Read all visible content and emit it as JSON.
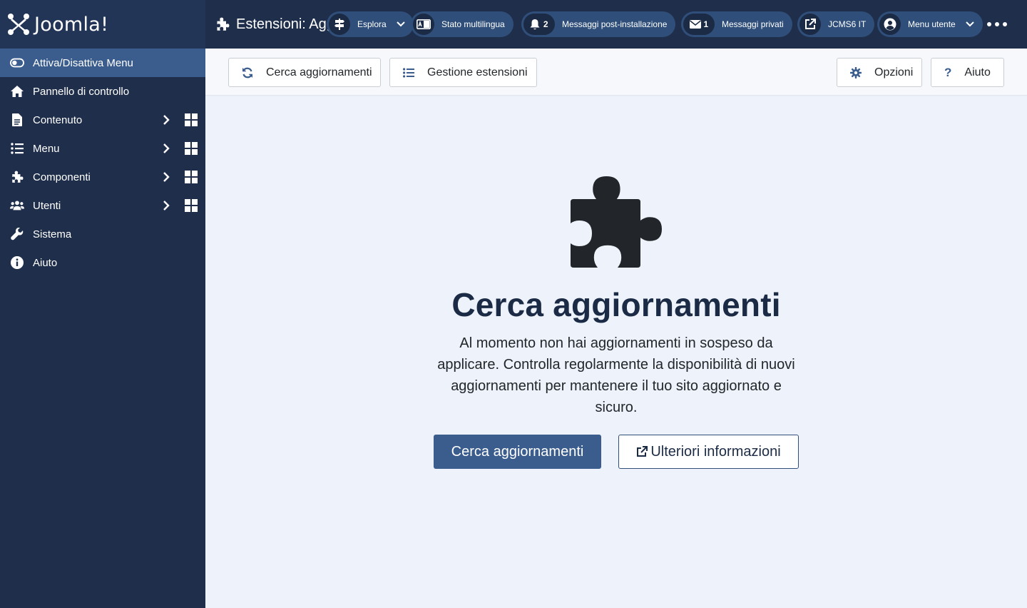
{
  "brand": {
    "name": "Joomla!"
  },
  "sidebar": {
    "items": [
      {
        "label": "Attiva/Disattiva Menu",
        "icon": "toggle-icon"
      },
      {
        "label": "Pannello di controllo",
        "icon": "home-icon"
      },
      {
        "label": "Contenuto",
        "icon": "file-icon"
      },
      {
        "label": "Menu",
        "icon": "list-icon"
      },
      {
        "label": "Componenti",
        "icon": "puzzle-icon"
      },
      {
        "label": "Utenti",
        "icon": "users-icon"
      },
      {
        "label": "Sistema",
        "icon": "wrench-icon"
      },
      {
        "label": "Aiuto",
        "icon": "info-icon"
      }
    ]
  },
  "header": {
    "title": "Estensioni: Aggiornamenti",
    "explore_label": "Esplora",
    "multilang_label": "Stato multilingua",
    "postinstall_count": "2",
    "postinstall_label": "Messaggi post-installazione",
    "private_count": "1",
    "private_label": "Messaggi privati",
    "site_label": "JCMS6 IT",
    "user_menu_label": "Menu utente"
  },
  "toolbar": {
    "check_updates_label": "Cerca aggiornamenti",
    "manage_label": "Gestione estensioni",
    "options_label": "Opzioni",
    "help_label": "Aiuto"
  },
  "empty_state": {
    "title": "Cerca aggiornamenti",
    "text": "Al momento non hai aggiornamenti in sospeso da applicare. Controlla regolarmente la disponibilità di nuovi aggiornamenti per mantenere il tuo sito aggiornato e sicuro.",
    "primary_label": "Cerca aggiornamenti",
    "secondary_label": "Ulteriori informazioni"
  },
  "colors": {
    "sidebar_bg": "#1f2f4b",
    "accent": "#3a5d8d",
    "page_bg": "#eef3fb",
    "heading": "#1c2b45"
  }
}
